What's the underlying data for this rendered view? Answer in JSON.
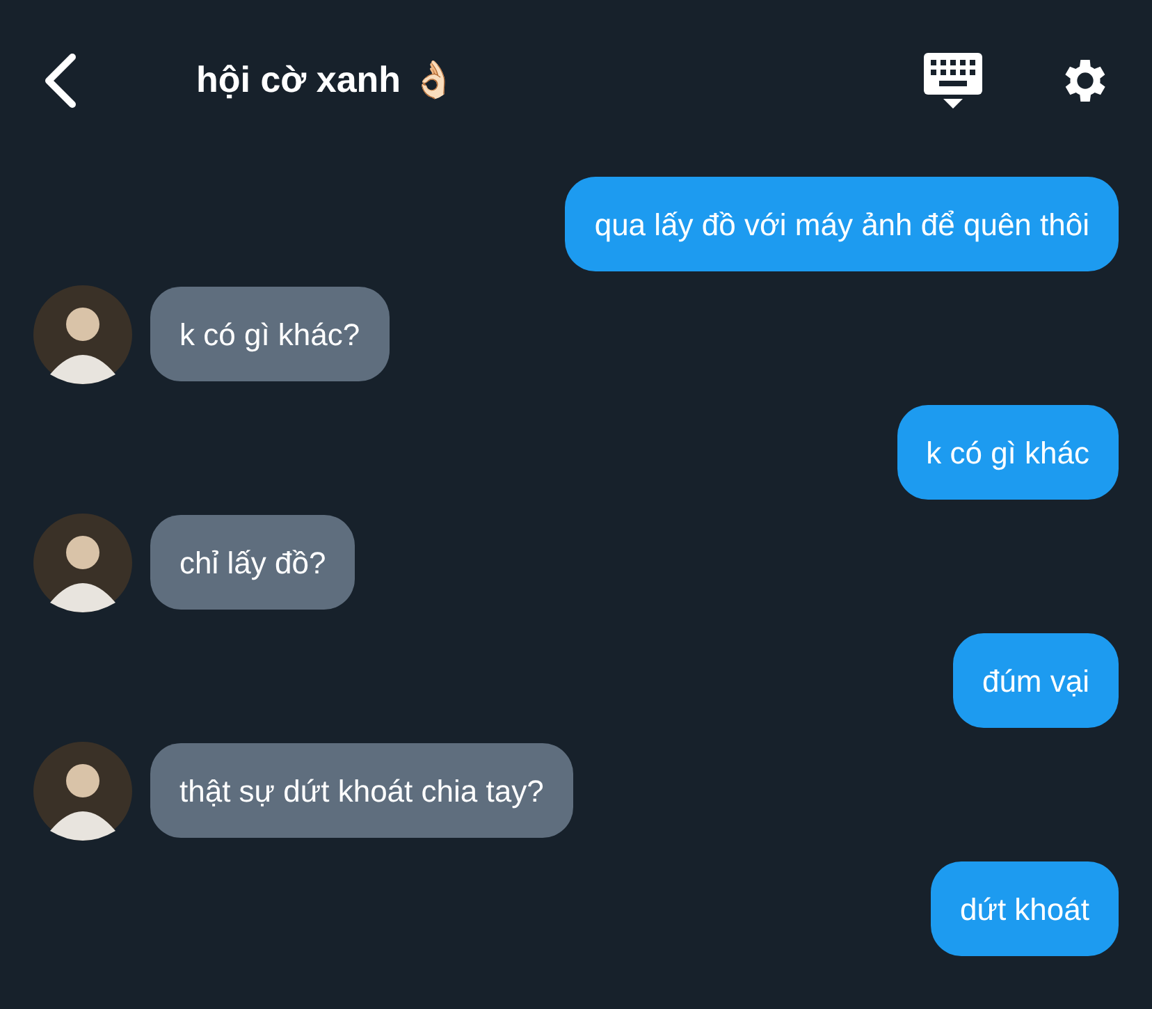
{
  "header": {
    "title": "hội cờ xanh 👌🏻"
  },
  "messages": [
    {
      "kind": "sent",
      "text": "qua lấy đồ với máy ảnh để quên thôi"
    },
    {
      "kind": "received",
      "text": "k có gì khác?"
    },
    {
      "kind": "sent",
      "text": "k có gì khác"
    },
    {
      "kind": "received",
      "text": "chỉ lấy đồ?"
    },
    {
      "kind": "sent",
      "text": "đúm vại"
    },
    {
      "kind": "received",
      "text": "thật sự dứt khoát chia tay?"
    },
    {
      "kind": "sent",
      "text": "dứt khoát"
    }
  ]
}
